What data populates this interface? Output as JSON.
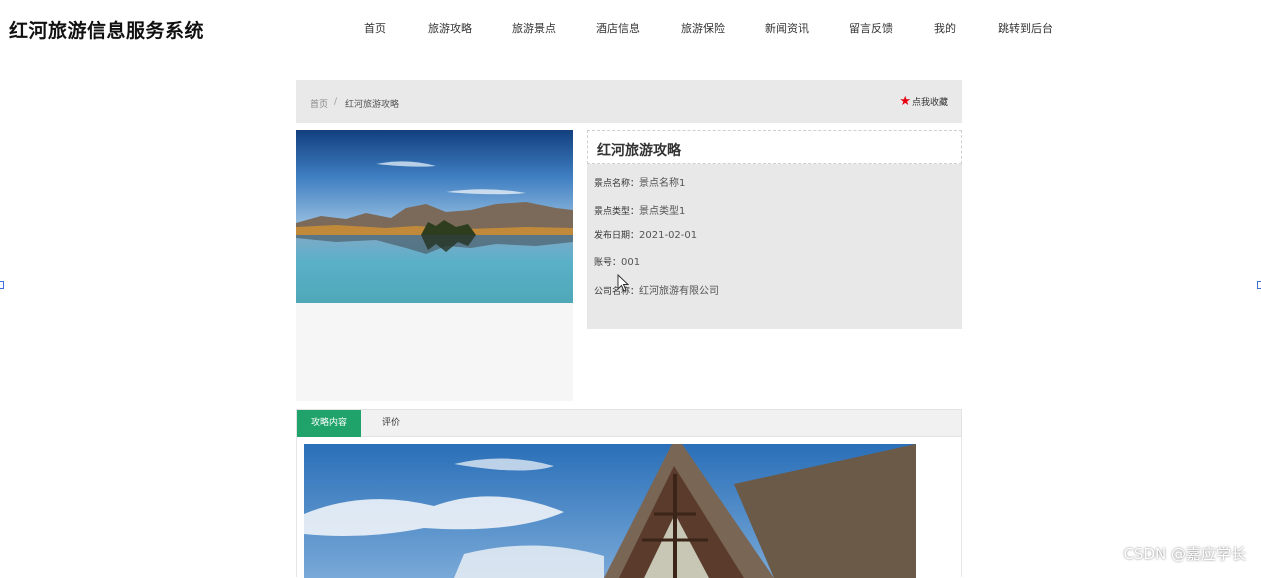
{
  "header": {
    "site_title": "红河旅游信息服务系统",
    "nav": [
      {
        "label": "首页"
      },
      {
        "label": "旅游攻略"
      },
      {
        "label": "旅游景点"
      },
      {
        "label": "酒店信息"
      },
      {
        "label": "旅游保险"
      },
      {
        "label": "新闻资讯"
      },
      {
        "label": "留言反馈"
      },
      {
        "label": "我的"
      },
      {
        "label": "跳转到后台"
      }
    ]
  },
  "breadcrumb": {
    "home": "首页",
    "separator": "/",
    "current": "红河旅游攻略",
    "favorite_label": "点我收藏",
    "favorite_icon": "star-icon",
    "favorite_color": "#e60012"
  },
  "detail": {
    "title": "红河旅游攻略",
    "fields": [
      {
        "label": "景点名称：",
        "value": "景点名称1"
      },
      {
        "label": "景点类型：",
        "value": "景点类型1"
      },
      {
        "label": "发布日期：",
        "value": "2021-02-01"
      },
      {
        "label": "账号：",
        "value": "001"
      },
      {
        "label": "公司名称：",
        "value": "红河旅游有限公司"
      }
    ]
  },
  "tabs": [
    {
      "label": "攻略内容",
      "active": true
    },
    {
      "label": "评价",
      "active": false
    }
  ],
  "accent_color": "#20a36a",
  "watermark": "CSDN @嘉应学长"
}
